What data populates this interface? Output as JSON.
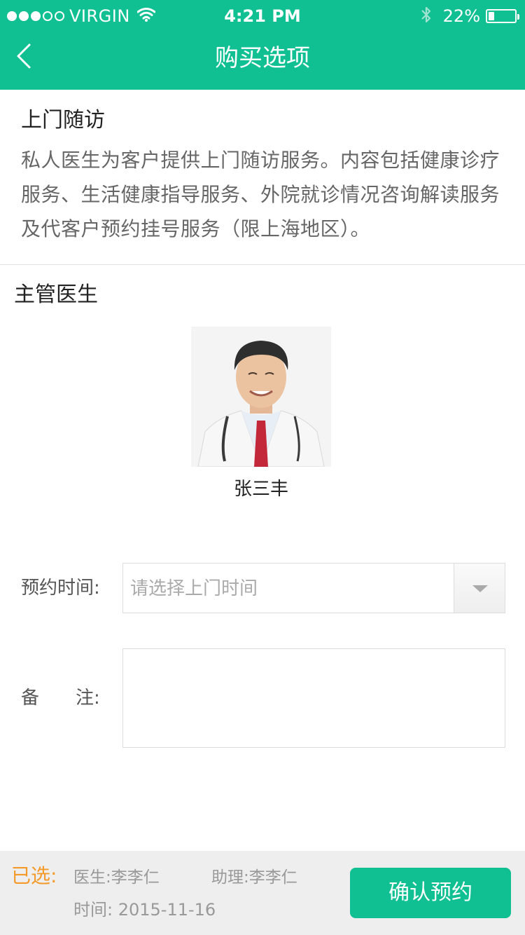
{
  "status_bar": {
    "carrier": "VIRGIN",
    "time": "4:21 PM",
    "battery_percent": "22%",
    "battery_level": 0.22,
    "signal_bars": 3,
    "signal_max": 5
  },
  "header": {
    "title": "购买选项",
    "back_icon": "chevron-left-icon",
    "background_color": "#10c093"
  },
  "service": {
    "title": "上门随访",
    "description": "私人医生为客户提供上门随访服务。内容包括健康诊疗服务、生活健康指导服务、外院就诊情况咨询解读服务及代客户预约挂号服务（限上海地区）。"
  },
  "doctor": {
    "heading": "主管医生",
    "name": "张三丰"
  },
  "form": {
    "time_label": "预约时间:",
    "time_placeholder": "请选择上门时间",
    "note_label": "备　　注:"
  },
  "footer": {
    "selected_label": "已选:",
    "doctor_text": "医生:李李仁",
    "assistant_text": "助理:李李仁",
    "time_text": "时间:  2015-11-16",
    "confirm_label": "确认预约",
    "accent_color": "#f39a2b"
  }
}
